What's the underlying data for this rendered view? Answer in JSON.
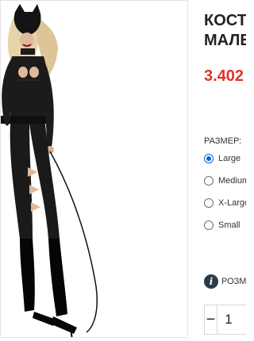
{
  "product": {
    "image_alt": "Catsuit costume photo",
    "title_line1": "КОСТЮМ",
    "title_line2": "МАЛЕНЬКОЙ",
    "price": "3.402"
  },
  "size_selector": {
    "label": "РАЗМЕР:",
    "options": [
      {
        "label": "Large",
        "selected": true
      },
      {
        "label": "Medium",
        "selected": false
      },
      {
        "label": "X-Large",
        "selected": false
      },
      {
        "label": "Small",
        "selected": false
      }
    ]
  },
  "size_chart": {
    "label": "РОЗМЕРЫ",
    "icon": "info-icon"
  },
  "quantity": {
    "minus_label": "−",
    "value": "1"
  },
  "colors": {
    "price": "#e4322a",
    "radio_selected": "#0a64c8"
  }
}
